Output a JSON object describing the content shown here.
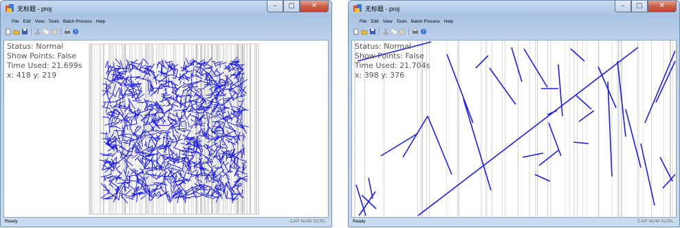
{
  "windows": [
    {
      "title": "无标题 - proj",
      "menu": [
        "File",
        "Edit",
        "View",
        "Tools",
        "Batch Process",
        "Help"
      ],
      "toolbar_icons": [
        "new-file-icon",
        "open-folder-icon",
        "save-icon",
        "cut-icon",
        "copy-icon",
        "paste-icon",
        "print-icon",
        "help-icon"
      ],
      "status": {
        "mode": "Status: Normal",
        "points": "Show Points: False",
        "time": "Time Used: 21.699s",
        "coords": "x: 418   y: 219"
      },
      "statusbar": {
        "ready": "Ready",
        "indicators": "CAP NUM SCRL"
      },
      "line_color": "#1a1aee"
    },
    {
      "title": "无标题 - proj",
      "menu": [
        "File",
        "Edit",
        "View",
        "Tools",
        "Batch Process",
        "Help"
      ],
      "toolbar_icons": [
        "new-file-icon",
        "open-folder-icon",
        "save-icon",
        "cut-icon",
        "copy-icon",
        "paste-icon",
        "print-icon",
        "help-icon"
      ],
      "status": {
        "mode": "Status: Normal",
        "points": "Show Points: False",
        "time": "Time Used: 21.704s",
        "coords": "x: 398   y: 376"
      },
      "statusbar": {
        "ready": "Ready",
        "indicators": "CAP NUM SCRL"
      },
      "line_color": "#1a1aee"
    }
  ]
}
